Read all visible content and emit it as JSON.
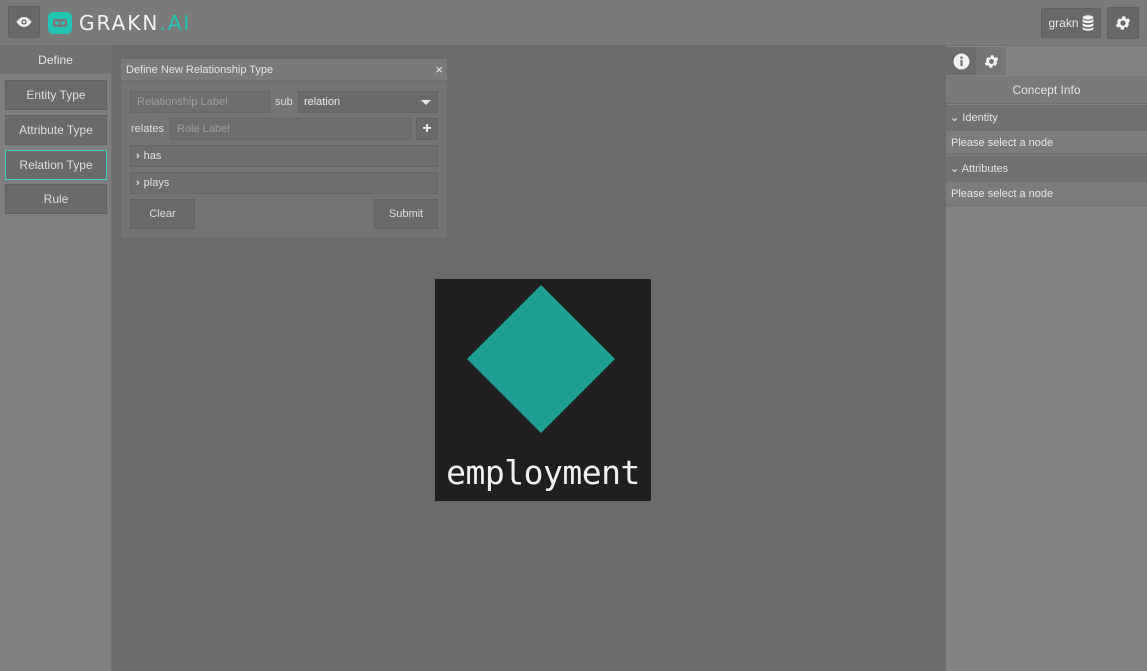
{
  "colors": {
    "accent": "#22c4b4",
    "node_diamond": "#1fa093",
    "node_bg": "#1f1f1f"
  },
  "topbar": {
    "logo": {
      "brand": "GRAKN",
      "dot": ".",
      "suffix": "AI"
    },
    "keyspace_label": "grakn",
    "icons": [
      "eye-icon",
      "database-icon",
      "gear-icon"
    ]
  },
  "left_panel": {
    "header": "Define",
    "buttons": [
      "Entity Type",
      "Attribute Type",
      "Relation Type",
      "Rule"
    ],
    "active": "Relation Type"
  },
  "modal": {
    "title": "Define New Relationship Type",
    "close": "×",
    "label_placeholder": "Relationship Label",
    "sub_label": "sub",
    "sub_value": "relation",
    "relates_label": "relates",
    "role_placeholder": "Role Label",
    "add": "+",
    "has_label": "has",
    "plays_label": "plays",
    "clear": "Clear",
    "submit": "Submit"
  },
  "graph": {
    "node_label": "employment",
    "node_shape": "diamond"
  },
  "right_panel": {
    "tabs": [
      "info-icon",
      "gear-icon"
    ],
    "title": "Concept Info",
    "identity_header": "Identity",
    "identity_body": "Please select a node",
    "attributes_header": "Attributes",
    "attributes_body": "Please select a node"
  }
}
